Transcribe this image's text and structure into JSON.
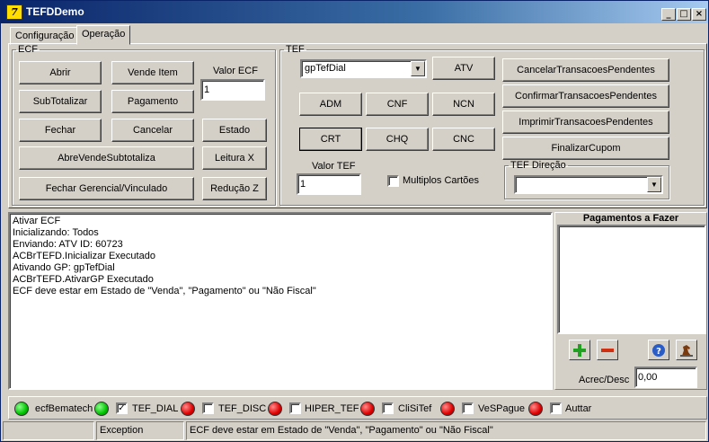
{
  "window": {
    "title": "TEFDDemo",
    "icon_letter": "7",
    "min": "_",
    "max": "□",
    "close": "×"
  },
  "tabs": [
    {
      "label": "Configuração"
    },
    {
      "label": "Operação"
    }
  ],
  "ecf": {
    "legend": "ECF",
    "abrir": "Abrir",
    "vende_item": "Vende Item",
    "valor_ecf_label": "Valor ECF",
    "valor_ecf": "1",
    "subtotalizar": "SubTotalizar",
    "pagamento": "Pagamento",
    "fechar": "Fechar",
    "cancelar": "Cancelar",
    "estado": "Estado",
    "abre_vende_subtotaliza": "AbreVendeSubtotaliza",
    "leitura_x": "Leitura X",
    "fechar_gerencial": "Fechar Gerencial/Vinculado",
    "reducao_z": "Redução Z"
  },
  "tef": {
    "legend": "TEF",
    "gp_selected": "gpTefDial",
    "atv": "ATV",
    "adm": "ADM",
    "cnf": "CNF",
    "ncn": "NCN",
    "crt": "CRT",
    "chq": "CHQ",
    "cnc": "CNC",
    "valor_tef_label": "Valor TEF",
    "valor_tef": "1",
    "multiplos_cartoes": "Multiplos Cartões",
    "cancelar_pendentes": "CancelarTransacoesPendentes",
    "confirmar_pendentes": "ConfirmarTransacoesPendentes",
    "imprimir_pendentes": "ImprimirTransacoesPendentes",
    "finalizar_cupom": "FinalizarCupom",
    "direcao_legend": "TEF Direção",
    "direcao_selected": ""
  },
  "log": {
    "lines": [
      "Ativar ECF",
      "Inicializando: Todos",
      "Enviando: ATV ID: 60723",
      "ACBrTEFD.Inicializar Executado",
      "Ativando GP: gpTefDial",
      "ACBrTEFD.AtivarGP Executado",
      "ECF deve estar em Estado de \"Venda\", \"Pagamento\" ou \"Não Fiscal\""
    ]
  },
  "pagamentos": {
    "title": "Pagamentos a Fazer",
    "acrec_label": "Acrec/Desc",
    "acrec_value": "0,00",
    "icons": [
      "add-icon",
      "remove-icon",
      "help-icon",
      "horse-icon"
    ]
  },
  "status_leds": [
    {
      "label": "ecfBematech",
      "color": "green",
      "has_checkbox": false
    },
    {
      "label": "TEF_DIAL",
      "color": "green",
      "has_checkbox": true,
      "checked": true
    },
    {
      "label": "TEF_DISC",
      "color": "red",
      "has_checkbox": true,
      "checked": false
    },
    {
      "label": "HIPER_TEF",
      "color": "red",
      "has_checkbox": true,
      "checked": false
    },
    {
      "label": "CliSiTef",
      "color": "red",
      "has_checkbox": true,
      "checked": false
    },
    {
      "label": "VeSPague",
      "color": "red",
      "has_checkbox": true,
      "checked": false
    },
    {
      "label": "Auttar",
      "color": "red",
      "has_checkbox": true,
      "checked": false
    }
  ],
  "statusbar": {
    "panel1": "",
    "panel2": "Exception",
    "panel3": "ECF deve estar em Estado de \"Venda\", \"Pagamento\" ou \"Não Fiscal\""
  },
  "colors": {
    "title_start": "#0a246a",
    "title_end": "#a6caf0",
    "face": "#d4d0c8",
    "led_green": "#00c400",
    "led_red": "#e00000"
  }
}
